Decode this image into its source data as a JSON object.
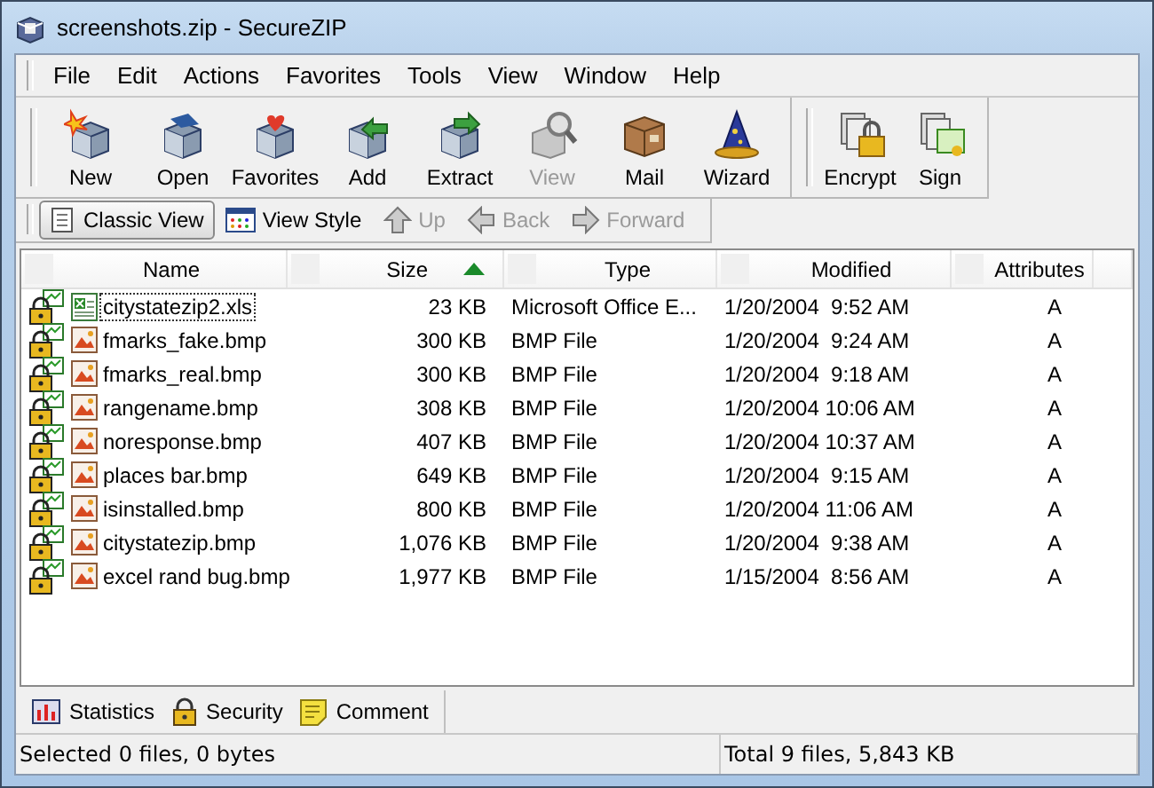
{
  "window": {
    "title": "screenshots.zip - SecureZIP"
  },
  "menu": [
    "File",
    "Edit",
    "Actions",
    "Favorites",
    "Tools",
    "View",
    "Window",
    "Help"
  ],
  "toolbar": [
    [
      {
        "label": "New",
        "disabled": false
      },
      {
        "label": "Open",
        "disabled": false
      },
      {
        "label": "Favorites",
        "disabled": false
      },
      {
        "label": "Add",
        "disabled": false
      },
      {
        "label": "Extract",
        "disabled": false
      },
      {
        "label": "View",
        "disabled": true
      },
      {
        "label": "Mail",
        "disabled": false
      },
      {
        "label": "Wizard",
        "disabled": false
      }
    ],
    [
      {
        "label": "Encrypt",
        "disabled": false
      },
      {
        "label": "Sign",
        "disabled": false
      }
    ]
  ],
  "view_bar": [
    {
      "label": "Classic View",
      "selected": true,
      "disabled": false
    },
    {
      "label": "View Style",
      "selected": false,
      "disabled": false
    },
    {
      "label": "Up",
      "selected": false,
      "disabled": true
    },
    {
      "label": "Back",
      "selected": false,
      "disabled": true
    },
    {
      "label": "Forward",
      "selected": false,
      "disabled": true
    }
  ],
  "table": {
    "columns": [
      {
        "label": "Name",
        "sorted": false
      },
      {
        "label": "Size",
        "sorted": true
      },
      {
        "label": "Type",
        "sorted": false
      },
      {
        "label": "Modified",
        "sorted": false
      },
      {
        "label": "Attributes",
        "sorted": false
      }
    ],
    "rows": [
      {
        "kind": "spreadsheet",
        "focused": true,
        "name": "citystatezip2.xls",
        "size": "23 KB",
        "type": "Microsoft Office E...",
        "modified": "1/20/2004  9:52 AM",
        "attributes": "A"
      },
      {
        "kind": "image",
        "focused": false,
        "name": "fmarks_fake.bmp",
        "size": "300 KB",
        "type": "BMP File",
        "modified": "1/20/2004  9:24 AM",
        "attributes": "A"
      },
      {
        "kind": "image",
        "focused": false,
        "name": "fmarks_real.bmp",
        "size": "300 KB",
        "type": "BMP File",
        "modified": "1/20/2004  9:18 AM",
        "attributes": "A"
      },
      {
        "kind": "image",
        "focused": false,
        "name": "rangename.bmp",
        "size": "308 KB",
        "type": "BMP File",
        "modified": "1/20/2004 10:06 AM",
        "attributes": "A"
      },
      {
        "kind": "image",
        "focused": false,
        "name": "noresponse.bmp",
        "size": "407 KB",
        "type": "BMP File",
        "modified": "1/20/2004 10:37 AM",
        "attributes": "A"
      },
      {
        "kind": "image",
        "focused": false,
        "name": "places bar.bmp",
        "size": "649 KB",
        "type": "BMP File",
        "modified": "1/20/2004  9:15 AM",
        "attributes": "A"
      },
      {
        "kind": "image",
        "focused": false,
        "name": "isinstalled.bmp",
        "size": "800 KB",
        "type": "BMP File",
        "modified": "1/20/2004 11:06 AM",
        "attributes": "A"
      },
      {
        "kind": "image",
        "focused": false,
        "name": "citystatezip.bmp",
        "size": "1,076 KB",
        "type": "BMP File",
        "modified": "1/20/2004  9:38 AM",
        "attributes": "A"
      },
      {
        "kind": "image",
        "focused": false,
        "name": "excel rand bug.bmp",
        "size": "1,977 KB",
        "type": "BMP File",
        "modified": "1/15/2004  8:56 AM",
        "attributes": "A"
      }
    ]
  },
  "bottom_tabs": [
    "Statistics",
    "Security",
    "Comment"
  ],
  "status_bar": [
    "Selected 0 files, 0 bytes",
    "Total 9 files, 5,843 KB"
  ]
}
